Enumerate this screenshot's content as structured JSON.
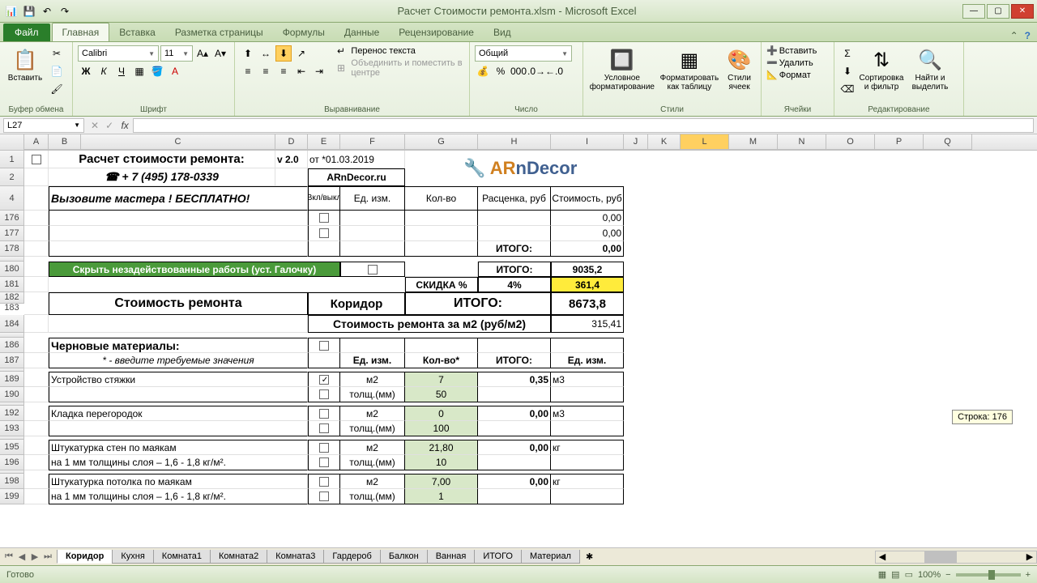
{
  "app": {
    "title": "Расчет Стоимости ремонта.xlsm  -  Microsoft Excel"
  },
  "ribbon": {
    "file": "Файл",
    "tabs": [
      "Главная",
      "Вставка",
      "Разметка страницы",
      "Формулы",
      "Данные",
      "Рецензирование",
      "Вид"
    ],
    "active": "Главная",
    "groups": {
      "clipboard": "Буфер обмена",
      "paste": "Вставить",
      "font": "Шрифт",
      "fontName": "Calibri",
      "fontSize": "11",
      "alignment": "Выравнивание",
      "wrap": "Перенос текста",
      "merge": "Объединить и поместить в центре",
      "number": "Число",
      "numberFormat": "Общий",
      "styles": "Стили",
      "condfmt": "Условное форматирование",
      "fmttable": "Форматировать как таблицу",
      "cellstyles": "Стили ячеек",
      "cells": "Ячейки",
      "insert": "Вставить",
      "delete": "Удалить",
      "format": "Формат",
      "editing": "Редактирование",
      "sortfilter": "Сортировка и фильтр",
      "findsel": "Найти и выделить"
    }
  },
  "formulabar": {
    "name": "L27",
    "formula": ""
  },
  "columns": [
    "A",
    "B",
    "C",
    "D",
    "E",
    "F",
    "G",
    "H",
    "I",
    "J",
    "K",
    "L",
    "M",
    "N",
    "O",
    "P",
    "Q"
  ],
  "rows": [
    "1",
    "2",
    "4",
    "176",
    "177",
    "178",
    "180",
    "181",
    "182",
    "183",
    "184",
    "186",
    "187",
    "189",
    "190",
    "192",
    "193",
    "195",
    "196",
    "198",
    "199"
  ],
  "content": {
    "header1": "Расчет стоимости ремонта:",
    "version": "v 2.0",
    "dateLabel": "от *01.03.2019",
    "phone": "☎ + 7 (495) 178-0339",
    "site": "ARnDecor.ru",
    "brand_ar": "AR",
    "brand_n": "n",
    "brand_decor": "Decor",
    "call": "Вызовите мастера ! БЕСПЛАТНО!",
    "hdr_vkl": "Вкл/выкл",
    "hdr_ed": "Ед. изм.",
    "hdr_kol": "Кол-во",
    "hdr_rate": "Расценка, руб",
    "hdr_cost": "Стоимость, руб",
    "zero": "0,00",
    "itogo": "ИТОГО:",
    "hide": "Скрыть незадействованные работы (уст. Галочку)",
    "itogo_val1": "9035,2",
    "discount": "СКИДКА %",
    "discount_pct": "4%",
    "discount_val": "361,4",
    "cost_title": "Стоимость ремонта",
    "room": "Коридор",
    "total": "8673,8",
    "per_m2": "Стоимость ремонта за м2 (руб/м2)",
    "per_m2_val": "315,41",
    "materials": "Черновые материалы:",
    "note": "* - введите требуемые значения",
    "hdr_kol2": "Кол-во*",
    "r189_name": "Устройство стяжки",
    "r189_u": "м2",
    "r189_q": "7",
    "r189_tot": "0,35",
    "r189_u2": "м3",
    "r190_u": "толщ.(мм)",
    "r190_q": "50",
    "r192_name": "Кладка перегородок",
    "r192_u": "м2",
    "r192_q": "0",
    "r192_tot": "0,00",
    "r192_u2": "м3",
    "r193_u": "толщ.(мм)",
    "r193_q": "100",
    "r195_name": "Штукатурка стен по маякам",
    "r195_u": "м2",
    "r195_q": "21,80",
    "r195_tot": "0,00",
    "r195_u2": "кг",
    "r196_name": "на 1 мм толщины слоя – 1,6 - 1,8 кг/м².",
    "r196_u": "толщ.(мм)",
    "r196_q": "10",
    "r198_name": "Штукатурка потолка по маякам",
    "r198_u": "м2",
    "r198_q": "7,00",
    "r198_tot": "0,00",
    "r198_u2": "кг",
    "r199_name": "на 1 мм толщины слоя – 1,6 - 1,8 кг/м².",
    "r199_u": "толщ.(мм)",
    "r199_q": "1"
  },
  "sheets": [
    "Коридор",
    "Кухня",
    "Комната1",
    "Комната2",
    "Комната3",
    "Гардероб",
    "Балкон",
    "Ванная",
    "ИТОГО",
    "Материал"
  ],
  "activeSheet": "Коридор",
  "status": {
    "ready": "Готово",
    "zoom": "100%",
    "tooltip": "Строка: 176"
  }
}
